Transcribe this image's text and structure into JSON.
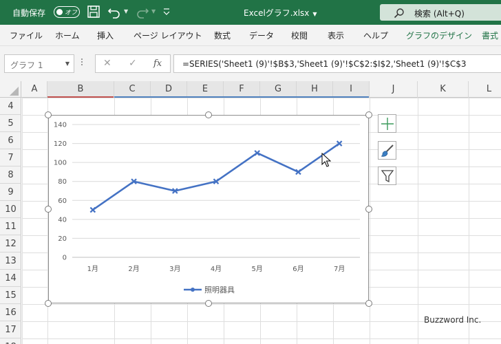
{
  "titlebar": {
    "autosave_label": "自動保存",
    "autosave_state": "オフ",
    "document_title": "Excelグラフ.xlsx",
    "search_label": "検索 (Alt+Q)"
  },
  "ribbon_tabs": [
    "ファイル",
    "ホーム",
    "挿入",
    "ページ レイアウト",
    "数式",
    "データ",
    "校閲",
    "表示",
    "ヘルプ",
    "グラフのデザイン",
    "書式"
  ],
  "formula_bar": {
    "name_box": "グラフ 1",
    "cancel_icon": "✕",
    "enter_icon": "✓",
    "fx_label": "fx",
    "formula": "=SERIES('Sheet1 (9)'!$B$3,'Sheet1 (9)'!$C$2:$I$2,'Sheet1 (9)'!$C$3"
  },
  "columns": [
    "A",
    "B",
    "C",
    "D",
    "E",
    "F",
    "G",
    "H",
    "I",
    "J",
    "K",
    "L"
  ],
  "rows": [
    "4",
    "5",
    "6",
    "7",
    "8",
    "9",
    "10",
    "11",
    "12",
    "13",
    "14",
    "15",
    "16",
    "17",
    "18"
  ],
  "chart_data": {
    "type": "line",
    "categories": [
      "1月",
      "2月",
      "3月",
      "4月",
      "5月",
      "6月",
      "7月"
    ],
    "series": [
      {
        "name": "照明器具",
        "values": [
          50,
          80,
          70,
          80,
          110,
          90,
          120
        ]
      }
    ],
    "ylim": [
      0,
      140
    ],
    "yticks": [
      0,
      20,
      40,
      60,
      80,
      100,
      120,
      140
    ],
    "grid": true,
    "legend": "bottom",
    "color": "#4472c4"
  },
  "chart_side_buttons": {
    "elements_icon": "plus-icon",
    "styles_icon": "brush-icon",
    "filters_icon": "filter-icon"
  },
  "watermark": "Buzzword Inc."
}
